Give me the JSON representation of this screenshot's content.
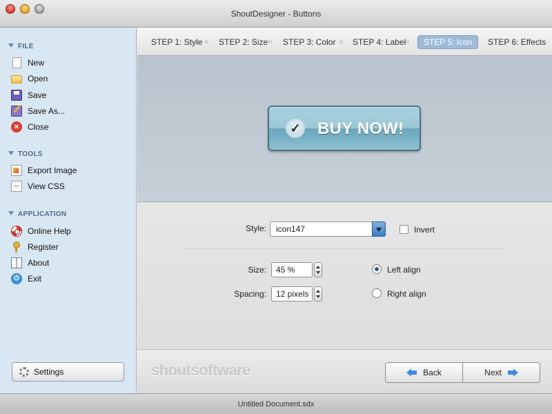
{
  "window": {
    "title": "ShoutDesigner - Buttons"
  },
  "sidebar": {
    "sections": [
      {
        "header": "FILE",
        "items": [
          {
            "label": "New",
            "icon": "new-document-icon"
          },
          {
            "label": "Open",
            "icon": "folder-icon"
          },
          {
            "label": "Save",
            "icon": "save-icon"
          },
          {
            "label": "Save As...",
            "icon": "save-as-icon"
          },
          {
            "label": "Close",
            "icon": "close-icon"
          }
        ]
      },
      {
        "header": "TOOLS",
        "items": [
          {
            "label": "Export Image",
            "icon": "image-icon"
          },
          {
            "label": "View CSS",
            "icon": "css-file-icon"
          }
        ]
      },
      {
        "header": "APPLICATION",
        "items": [
          {
            "label": "Online Help",
            "icon": "lifebuoy-icon"
          },
          {
            "label": "Register",
            "icon": "key-icon"
          },
          {
            "label": "About",
            "icon": "book-icon"
          },
          {
            "label": "Exit",
            "icon": "power-icon"
          }
        ]
      }
    ],
    "settings_label": "Settings"
  },
  "steps": [
    {
      "label": "STEP 1: Style",
      "active": false
    },
    {
      "label": "STEP 2: Size",
      "active": false
    },
    {
      "label": "STEP 3: Color",
      "active": false
    },
    {
      "label": "STEP 4: Label",
      "active": false
    },
    {
      "label": "STEP 5: Icon",
      "active": true
    },
    {
      "label": "STEP 6: Effects",
      "active": false
    }
  ],
  "step_separator": "»",
  "preview": {
    "button_text": "BUY NOW!",
    "button_icon": "✓",
    "button_color": "#9dc8d6"
  },
  "panel": {
    "style_label": "Style:",
    "style_value": "icon147",
    "invert_label": "Invert",
    "invert_checked": false,
    "size_label": "Size:",
    "size_value": "45 %",
    "spacing_label": "Spacing:",
    "spacing_value": "12 pixels",
    "align_options": [
      {
        "label": "Left align",
        "selected": true
      },
      {
        "label": "Right align",
        "selected": false
      }
    ]
  },
  "footer": {
    "logo_text": "shoutsoftware",
    "back_label": "Back",
    "next_label": "Next"
  },
  "status": {
    "document": "Untitled Document.sdx"
  },
  "colors": {
    "accent": "#9dbbd7",
    "sidebar_bg": "#d9e7f3",
    "arrow": "#3d8ae0"
  }
}
